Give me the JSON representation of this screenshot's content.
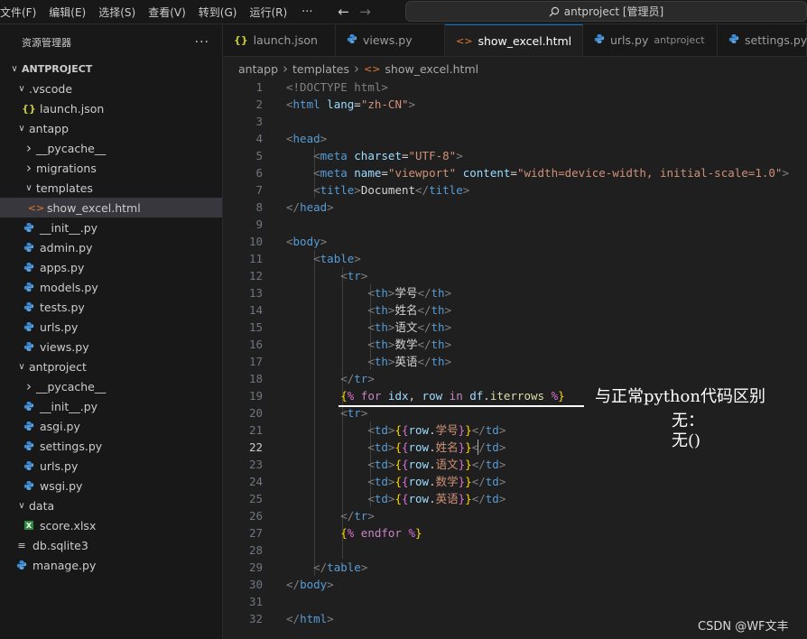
{
  "menu": {
    "items": [
      "文件(F)",
      "编辑(E)",
      "选择(S)",
      "查看(V)",
      "转到(G)",
      "运行(R)"
    ],
    "more": "···",
    "back_icon": "arrow-left-icon",
    "forward_icon": "arrow-right-icon"
  },
  "search": {
    "text": "antproject [管理员]"
  },
  "explorer": {
    "title": "资源管理器",
    "more": "···",
    "root": "ANTPROJECT",
    "tree": [
      {
        "label": ".vscode",
        "kind": "folder",
        "open": true,
        "depth": 1
      },
      {
        "label": "launch.json",
        "kind": "json",
        "depth": 2
      },
      {
        "label": "antapp",
        "kind": "folder",
        "open": true,
        "depth": 1
      },
      {
        "label": "__pycache__",
        "kind": "folder",
        "open": false,
        "depth": 2
      },
      {
        "label": "migrations",
        "kind": "folder",
        "open": false,
        "depth": 2
      },
      {
        "label": "templates",
        "kind": "folder",
        "open": true,
        "depth": 2
      },
      {
        "label": "show_excel.html",
        "kind": "html",
        "depth": 3,
        "selected": true
      },
      {
        "label": "__init__.py",
        "kind": "py",
        "depth": 2
      },
      {
        "label": "admin.py",
        "kind": "py",
        "depth": 2
      },
      {
        "label": "apps.py",
        "kind": "py",
        "depth": 2
      },
      {
        "label": "models.py",
        "kind": "py",
        "depth": 2
      },
      {
        "label": "tests.py",
        "kind": "py",
        "depth": 2
      },
      {
        "label": "urls.py",
        "kind": "py",
        "depth": 2
      },
      {
        "label": "views.py",
        "kind": "py",
        "depth": 2
      },
      {
        "label": "antproject",
        "kind": "folder",
        "open": true,
        "depth": 1
      },
      {
        "label": "__pycache__",
        "kind": "folder",
        "open": false,
        "depth": 2
      },
      {
        "label": "__init__.py",
        "kind": "py",
        "depth": 2
      },
      {
        "label": "asgi.py",
        "kind": "py",
        "depth": 2
      },
      {
        "label": "settings.py",
        "kind": "py",
        "depth": 2
      },
      {
        "label": "urls.py",
        "kind": "py",
        "depth": 2
      },
      {
        "label": "wsgi.py",
        "kind": "py",
        "depth": 2
      },
      {
        "label": "data",
        "kind": "folder",
        "open": true,
        "depth": 1
      },
      {
        "label": "score.xlsx",
        "kind": "xlsx",
        "depth": 2
      },
      {
        "label": "db.sqlite3",
        "kind": "db",
        "depth": 1
      },
      {
        "label": "manage.py",
        "kind": "py",
        "depth": 1
      }
    ]
  },
  "tabs": [
    {
      "label": "launch.json",
      "kind": "json"
    },
    {
      "label": "views.py",
      "kind": "py"
    },
    {
      "label": "show_excel.html",
      "kind": "html",
      "active": true,
      "dirty": true
    },
    {
      "label": "urls.py",
      "kind": "py",
      "desc": "antproject"
    },
    {
      "label": "settings.py",
      "kind": "py"
    }
  ],
  "breadcrumb": [
    "antapp",
    "templates",
    "show_excel.html"
  ],
  "editor": {
    "active_line": 22,
    "lines": [
      [
        [
          "t",
          "<!DOCTYPE html>"
        ]
      ],
      [
        [
          "t",
          "<"
        ],
        [
          "tag",
          "html"
        ],
        [
          "attr",
          " lang"
        ],
        [
          "txt",
          "="
        ],
        [
          "str",
          "\"zh-CN\""
        ],
        [
          "t",
          ">"
        ]
      ],
      [],
      [
        [
          "t",
          "<"
        ],
        [
          "tag",
          "head"
        ],
        [
          "t",
          ">"
        ]
      ],
      [
        [
          "txt",
          "    "
        ],
        [
          "t",
          "<"
        ],
        [
          "tag",
          "meta"
        ],
        [
          "attr",
          " charset"
        ],
        [
          "txt",
          "="
        ],
        [
          "str",
          "\"UTF-8\""
        ],
        [
          "t",
          ">"
        ]
      ],
      [
        [
          "txt",
          "    "
        ],
        [
          "t",
          "<"
        ],
        [
          "tag",
          "meta"
        ],
        [
          "attr",
          " name"
        ],
        [
          "txt",
          "="
        ],
        [
          "str",
          "\"viewport\""
        ],
        [
          "attr",
          " content"
        ],
        [
          "txt",
          "="
        ],
        [
          "str",
          "\"width=device-width, initial-scale=1.0\""
        ],
        [
          "t",
          ">"
        ]
      ],
      [
        [
          "txt",
          "    "
        ],
        [
          "t",
          "<"
        ],
        [
          "tag",
          "title"
        ],
        [
          "t",
          ">"
        ],
        [
          "txt",
          "Document"
        ],
        [
          "t",
          "</"
        ],
        [
          "tag",
          "title"
        ],
        [
          "t",
          ">"
        ]
      ],
      [
        [
          "t",
          "</"
        ],
        [
          "tag",
          "head"
        ],
        [
          "t",
          ">"
        ]
      ],
      [],
      [
        [
          "t",
          "<"
        ],
        [
          "tag",
          "body"
        ],
        [
          "t",
          ">"
        ]
      ],
      [
        [
          "txt",
          "    "
        ],
        [
          "t",
          "<"
        ],
        [
          "tag",
          "table"
        ],
        [
          "t",
          ">"
        ]
      ],
      [
        [
          "txt",
          "        "
        ],
        [
          "t",
          "<"
        ],
        [
          "tag",
          "tr"
        ],
        [
          "t",
          ">"
        ]
      ],
      [
        [
          "txt",
          "            "
        ],
        [
          "t",
          "<"
        ],
        [
          "tag",
          "th"
        ],
        [
          "t",
          ">"
        ],
        [
          "txt",
          "学号"
        ],
        [
          "t",
          "</"
        ],
        [
          "tag",
          "th"
        ],
        [
          "t",
          ">"
        ]
      ],
      [
        [
          "txt",
          "            "
        ],
        [
          "t",
          "<"
        ],
        [
          "tag",
          "th"
        ],
        [
          "t",
          ">"
        ],
        [
          "txt",
          "姓名"
        ],
        [
          "t",
          "</"
        ],
        [
          "tag",
          "th"
        ],
        [
          "t",
          ">"
        ]
      ],
      [
        [
          "txt",
          "            "
        ],
        [
          "t",
          "<"
        ],
        [
          "tag",
          "th"
        ],
        [
          "t",
          ">"
        ],
        [
          "txt",
          "语文"
        ],
        [
          "t",
          "</"
        ],
        [
          "tag",
          "th"
        ],
        [
          "t",
          ">"
        ]
      ],
      [
        [
          "txt",
          "            "
        ],
        [
          "t",
          "<"
        ],
        [
          "tag",
          "th"
        ],
        [
          "t",
          ">"
        ],
        [
          "txt",
          "数学"
        ],
        [
          "t",
          "</"
        ],
        [
          "tag",
          "th"
        ],
        [
          "t",
          ">"
        ]
      ],
      [
        [
          "txt",
          "            "
        ],
        [
          "t",
          "<"
        ],
        [
          "tag",
          "th"
        ],
        [
          "t",
          ">"
        ],
        [
          "txt",
          "英语"
        ],
        [
          "t",
          "</"
        ],
        [
          "tag",
          "th"
        ],
        [
          "t",
          ">"
        ]
      ],
      [
        [
          "txt",
          "        "
        ],
        [
          "t",
          "</"
        ],
        [
          "tag",
          "tr"
        ],
        [
          "t",
          ">"
        ]
      ],
      [
        [
          "txt",
          "        "
        ],
        [
          "brace",
          "{"
        ],
        [
          "brace2",
          "%"
        ],
        [
          "kw",
          " for"
        ],
        [
          "ident",
          " idx"
        ],
        [
          "txt",
          ","
        ],
        [
          "ident",
          " row"
        ],
        [
          "kw",
          " in"
        ],
        [
          "ident",
          " df"
        ],
        [
          "txt",
          "."
        ],
        [
          "fn",
          "iterrows"
        ],
        [
          "brace2",
          " %"
        ],
        [
          "brace",
          "}"
        ]
      ],
      [
        [
          "txt",
          "        "
        ],
        [
          "t",
          "<"
        ],
        [
          "tag",
          "tr"
        ],
        [
          "t",
          ">"
        ]
      ],
      [
        [
          "txt",
          "            "
        ],
        [
          "t",
          "<"
        ],
        [
          "tag",
          "td"
        ],
        [
          "t",
          ">"
        ],
        [
          "brace",
          "{"
        ],
        [
          "brace2",
          "{"
        ],
        [
          "ident",
          "row"
        ],
        [
          "txt",
          "."
        ],
        [
          "str",
          "学号"
        ],
        [
          "brace2",
          "}"
        ],
        [
          "brace",
          "}"
        ],
        [
          "t",
          "</"
        ],
        [
          "tag",
          "td"
        ],
        [
          "t",
          ">"
        ]
      ],
      [
        [
          "txt",
          "            "
        ],
        [
          "t",
          "<"
        ],
        [
          "tag",
          "td"
        ],
        [
          "t",
          ">"
        ],
        [
          "brace",
          "{"
        ],
        [
          "brace2",
          "{"
        ],
        [
          "ident",
          "row"
        ],
        [
          "txt",
          "."
        ],
        [
          "str",
          "姓名"
        ],
        [
          "brace2",
          "}"
        ],
        [
          "brace",
          "}"
        ],
        [
          "t",
          "</"
        ],
        [
          "tag",
          "td"
        ],
        [
          "t",
          ">"
        ]
      ],
      [
        [
          "txt",
          "            "
        ],
        [
          "t",
          "<"
        ],
        [
          "tag",
          "td"
        ],
        [
          "t",
          ">"
        ],
        [
          "brace",
          "{"
        ],
        [
          "brace2",
          "{"
        ],
        [
          "ident",
          "row"
        ],
        [
          "txt",
          "."
        ],
        [
          "str",
          "语文"
        ],
        [
          "brace2",
          "}"
        ],
        [
          "brace",
          "}"
        ],
        [
          "t",
          "</"
        ],
        [
          "tag",
          "td"
        ],
        [
          "t",
          ">"
        ]
      ],
      [
        [
          "txt",
          "            "
        ],
        [
          "t",
          "<"
        ],
        [
          "tag",
          "td"
        ],
        [
          "t",
          ">"
        ],
        [
          "brace",
          "{"
        ],
        [
          "brace2",
          "{"
        ],
        [
          "ident",
          "row"
        ],
        [
          "txt",
          "."
        ],
        [
          "str",
          "数学"
        ],
        [
          "brace2",
          "}"
        ],
        [
          "brace",
          "}"
        ],
        [
          "t",
          "</"
        ],
        [
          "tag",
          "td"
        ],
        [
          "t",
          ">"
        ]
      ],
      [
        [
          "txt",
          "            "
        ],
        [
          "t",
          "<"
        ],
        [
          "tag",
          "td"
        ],
        [
          "t",
          ">"
        ],
        [
          "brace",
          "{"
        ],
        [
          "brace2",
          "{"
        ],
        [
          "ident",
          "row"
        ],
        [
          "txt",
          "."
        ],
        [
          "str",
          "英语"
        ],
        [
          "brace2",
          "}"
        ],
        [
          "brace",
          "}"
        ],
        [
          "t",
          "</"
        ],
        [
          "tag",
          "td"
        ],
        [
          "t",
          ">"
        ]
      ],
      [
        [
          "txt",
          "        "
        ],
        [
          "t",
          "</"
        ],
        [
          "tag",
          "tr"
        ],
        [
          "t",
          ">"
        ]
      ],
      [
        [
          "txt",
          "        "
        ],
        [
          "brace",
          "{"
        ],
        [
          "brace2",
          "%"
        ],
        [
          "kw",
          " endfor"
        ],
        [
          "brace2",
          " %"
        ],
        [
          "brace",
          "}"
        ]
      ],
      [],
      [
        [
          "txt",
          "    "
        ],
        [
          "t",
          "</"
        ],
        [
          "tag",
          "table"
        ],
        [
          "t",
          ">"
        ]
      ],
      [
        [
          "t",
          "</"
        ],
        [
          "tag",
          "body"
        ],
        [
          "t",
          ">"
        ]
      ],
      [],
      [
        [
          "t",
          "</"
        ],
        [
          "tag",
          "html"
        ],
        [
          "t",
          ">"
        ]
      ]
    ]
  },
  "annotation": {
    "line1": "与正常python代码区别",
    "line2": "无：",
    "line3": "无()"
  },
  "watermark": "CSDN @WF文丰",
  "colors": {
    "accent": "#0078d4",
    "json_icon": "#cbcb41",
    "html_icon": "#e37933",
    "python_icon": "#3b8bd6",
    "xlsx_icon": "#2b8a3e"
  }
}
